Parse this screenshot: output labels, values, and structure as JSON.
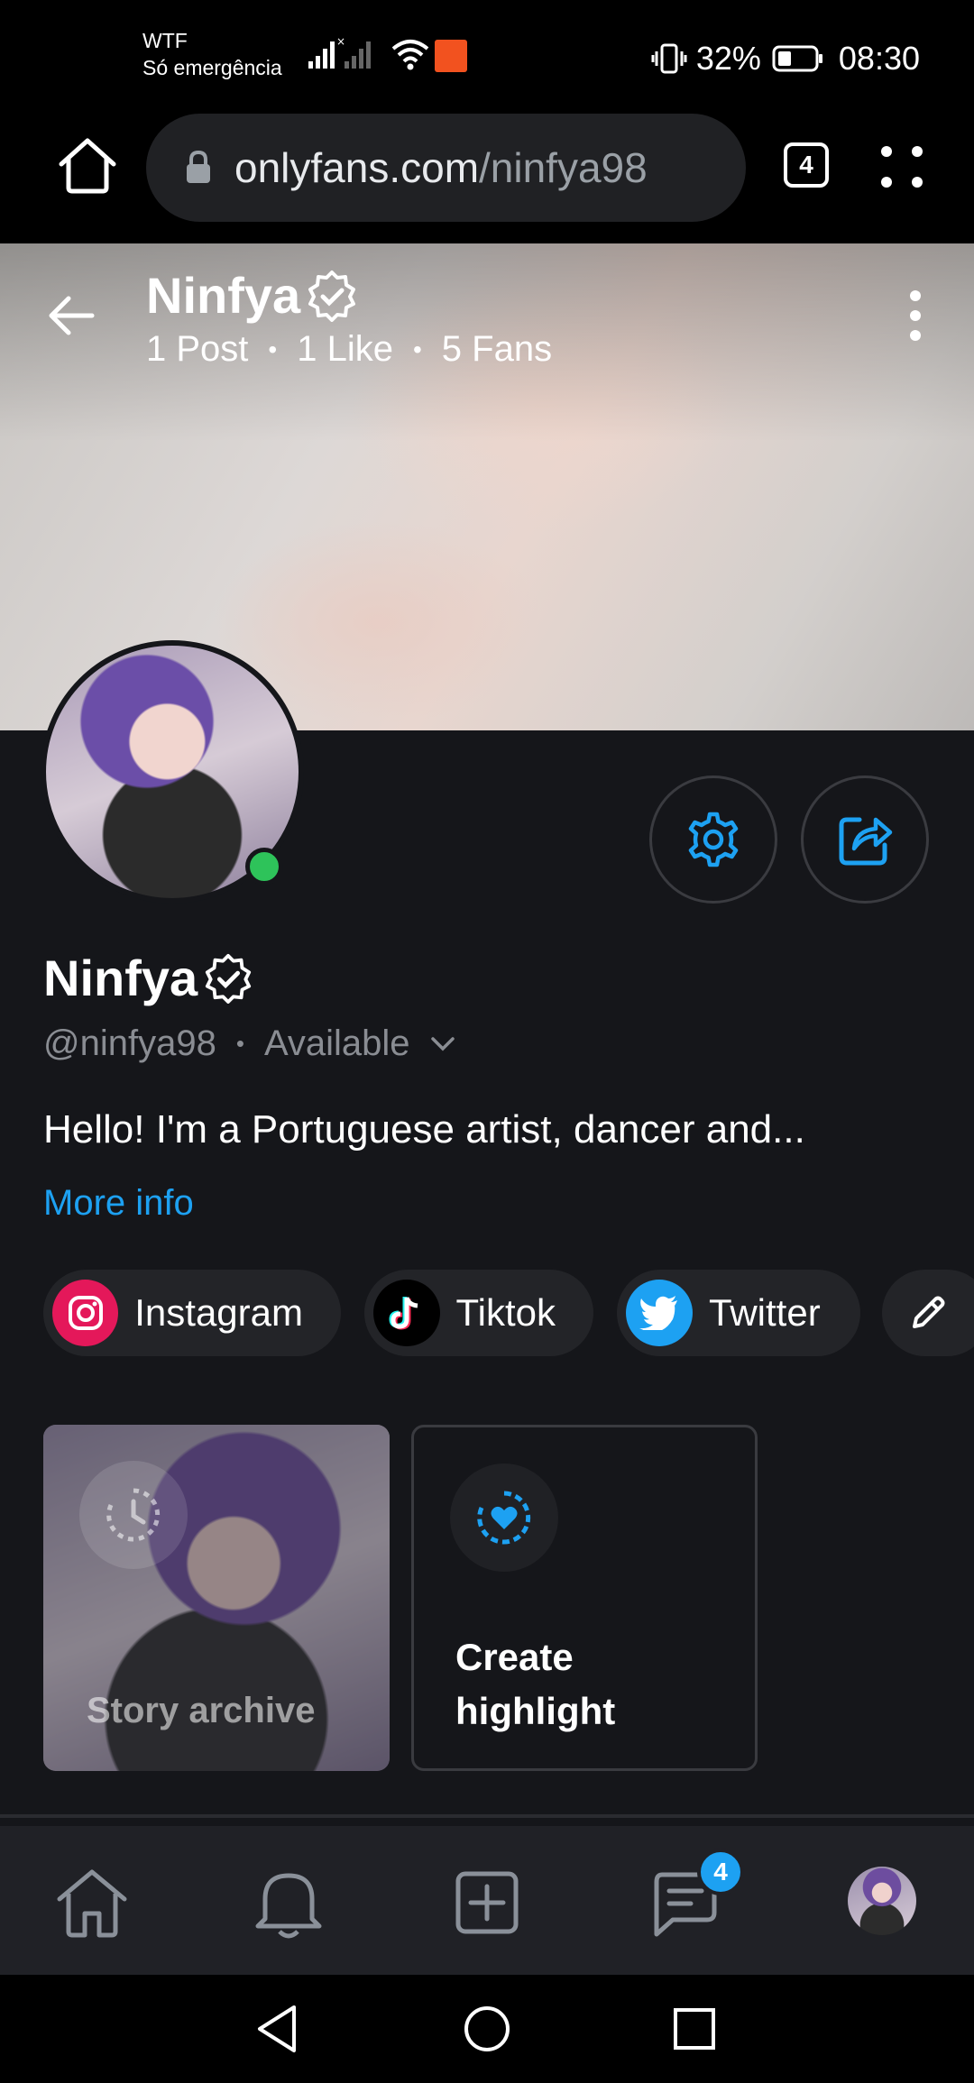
{
  "status_bar": {
    "carrier_name": "WTF",
    "carrier_status": "Só emergência",
    "battery_percent": "32%",
    "time": "08:30"
  },
  "browser": {
    "url_domain": "onlyfans.com",
    "url_path": "/ninfya98",
    "tab_count": "4"
  },
  "cover": {
    "name": "Ninfya",
    "posts": "1 Post",
    "likes": "1 Like",
    "fans": "5 Fans"
  },
  "profile": {
    "display_name": "Ninfya",
    "handle": "@ninfya98",
    "availability": "Available",
    "bio": "Hello! I'm a Portuguese artist, dancer and...",
    "more_info": "More info",
    "online_color": "#2ec35a",
    "accent_color": "#1da1f2"
  },
  "socials": [
    {
      "label": "Instagram",
      "icon": "instagram-icon"
    },
    {
      "label": "Tiktok",
      "icon": "tiktok-icon"
    },
    {
      "label": "Twitter",
      "icon": "twitter-icon"
    }
  ],
  "highlights": {
    "story_archive": "Story archive",
    "create_highlight": "Create highlight"
  },
  "bottom_nav": {
    "messages_badge": "4",
    "items": [
      "home-icon",
      "bell-icon",
      "add-post-icon",
      "messages-icon",
      "profile-avatar"
    ]
  }
}
